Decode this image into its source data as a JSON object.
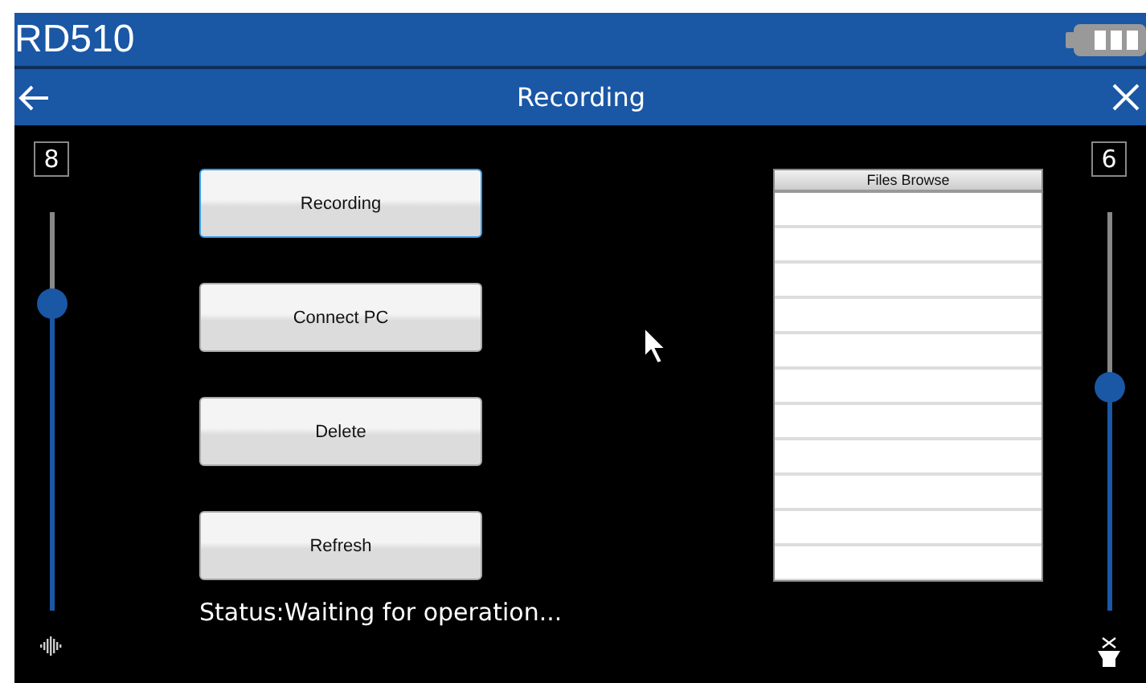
{
  "header": {
    "title": "RD510"
  },
  "titlebar": {
    "title": "Recording"
  },
  "left_slider": {
    "value": "8",
    "level": 0.77
  },
  "right_slider": {
    "value": "6",
    "level": 0.56
  },
  "buttons": [
    {
      "label": "Recording",
      "selected": true
    },
    {
      "label": "Connect PC",
      "selected": false
    },
    {
      "label": "Delete",
      "selected": false
    },
    {
      "label": "Refresh",
      "selected": false
    }
  ],
  "status": "Status:Waiting for operation...",
  "files": {
    "title": "Files Browse"
  }
}
